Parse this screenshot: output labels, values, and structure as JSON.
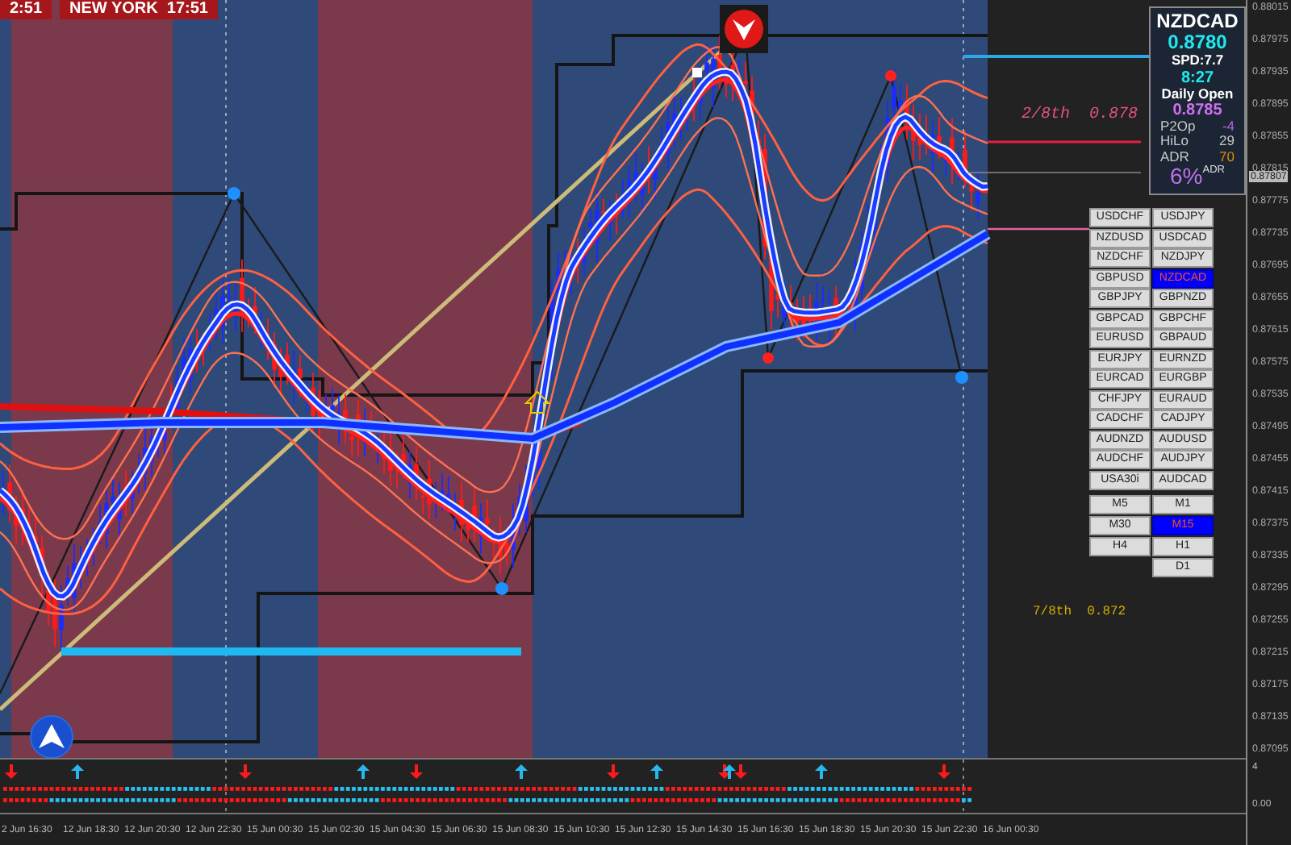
{
  "session_clocks": [
    "2:51",
    "NEW YORK  17:51"
  ],
  "info_panel": {
    "symbol": "NZDCAD",
    "bid": "0.8780",
    "spread": "SPD:7.7",
    "timer": "8:27",
    "daily_open_label": "Daily Open",
    "daily_open": "0.8785",
    "stats": [
      {
        "label": "P2Op",
        "value": "-4",
        "color": "#c060e0"
      },
      {
        "label": "HiLo",
        "value": "29",
        "color": "#c8c8c8"
      },
      {
        "label": "ADR",
        "value": "70",
        "color": "#e08a00"
      }
    ],
    "adr_percent": "6%",
    "adr_suffix": "ADR"
  },
  "levels": [
    {
      "label": "2/8th",
      "price": "0.878",
      "kind": "upper"
    },
    {
      "label": "7/8th",
      "price": "0.872",
      "kind": "lower"
    }
  ],
  "symbols": [
    {
      "label": "USDCHF",
      "selected": false
    },
    {
      "label": "USDJPY",
      "selected": false
    },
    {
      "label": "NZDUSD",
      "selected": false
    },
    {
      "label": "USDCAD",
      "selected": false
    },
    {
      "label": "NZDCHF",
      "selected": false
    },
    {
      "label": "NZDJPY",
      "selected": false
    },
    {
      "label": "GBPUSD",
      "selected": false
    },
    {
      "label": "NZDCAD",
      "selected": true
    },
    {
      "label": "GBPJPY",
      "selected": false
    },
    {
      "label": "GBPNZD",
      "selected": false
    },
    {
      "label": "GBPCAD",
      "selected": false
    },
    {
      "label": "GBPCHF",
      "selected": false
    },
    {
      "label": "EURUSD",
      "selected": false
    },
    {
      "label": "GBPAUD",
      "selected": false
    },
    {
      "label": "EURJPY",
      "selected": false
    },
    {
      "label": "EURNZD",
      "selected": false
    },
    {
      "label": "EURCAD",
      "selected": false
    },
    {
      "label": "EURGBP",
      "selected": false
    },
    {
      "label": "CHFJPY",
      "selected": false
    },
    {
      "label": "EURAUD",
      "selected": false
    },
    {
      "label": "CADCHF",
      "selected": false
    },
    {
      "label": "CADJPY",
      "selected": false
    },
    {
      "label": "AUDNZD",
      "selected": false
    },
    {
      "label": "AUDUSD",
      "selected": false
    },
    {
      "label": "AUDCHF",
      "selected": false
    },
    {
      "label": "AUDJPY",
      "selected": false
    },
    {
      "label": "USA30i",
      "selected": false
    },
    {
      "label": "AUDCAD",
      "selected": false
    }
  ],
  "timeframes": {
    "left": [
      {
        "label": "M5",
        "selected": false
      },
      {
        "label": "M30",
        "selected": false
      },
      {
        "label": "H4",
        "selected": false
      }
    ],
    "right": [
      {
        "label": "M1",
        "selected": false
      },
      {
        "label": "M15",
        "selected": true
      },
      {
        "label": "H1",
        "selected": false
      },
      {
        "label": "D1",
        "selected": false
      }
    ]
  },
  "price_axis": {
    "labels": [
      "0.88015",
      "0.87975",
      "0.87935",
      "0.87895",
      "0.87855",
      "0.87815",
      "0.87775",
      "0.87735",
      "0.87695",
      "0.87655",
      "0.87615",
      "0.87575",
      "0.87535",
      "0.87495",
      "0.87455",
      "0.87415",
      "0.87375",
      "0.87335",
      "0.87295",
      "0.87255",
      "0.87215",
      "0.87175",
      "0.87135",
      "0.87095"
    ],
    "current": "0.87807"
  },
  "indicator_axis": [
    "4",
    "0.00"
  ],
  "time_axis": [
    "2 Jun 16:30",
    "12 Jun 18:30",
    "12 Jun 20:30",
    "12 Jun 22:30",
    "15 Jun 00:30",
    "15 Jun 02:30",
    "15 Jun 04:30",
    "15 Jun 06:30",
    "15 Jun 08:30",
    "15 Jun 10:30",
    "15 Jun 12:30",
    "15 Jun 14:30",
    "15 Jun 16:30",
    "15 Jun 18:30",
    "15 Jun 20:30",
    "15 Jun 22:30",
    "16 Jun 00:30"
  ]
}
